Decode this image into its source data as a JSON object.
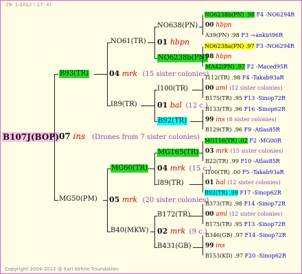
{
  "header": "29- 1-2012 ( 17: 4)",
  "copyright": "Copyright 2004-2012 @ Karl Kehrle Foundation.",
  "root": {
    "name": "B107J(BOP)",
    "num": "07",
    "qual": "ins",
    "note": "(Drones from 7 sister colonies)"
  },
  "g1": [
    {
      "name": "B93(TR)",
      "num": "04",
      "qual": "mrk",
      "note": "(15 sister colonies)"
    },
    {
      "name": "MG50(PM)",
      "num": "05",
      "qual": "mrk",
      "note": "(20 sister colonies)"
    }
  ],
  "g2": [
    {
      "name": "NO61(TR)",
      "num": "01",
      "qual": "hbpn",
      "note": ""
    },
    {
      "name": "I89(TR)",
      "num": "01",
      "qual": "bal",
      "note": "(12 c.)"
    },
    {
      "name": "MG60(TR)",
      "num": "04",
      "qual": "mrk",
      "note": "(15 c.)"
    },
    {
      "name": "B40(MKW)",
      "num": "02",
      "qual": "mrk",
      "note": "(9 c.)"
    }
  ],
  "g3": [
    {
      "name": "NO638(PN)",
      "num": "00",
      "qual": "hbpn",
      "note": ""
    },
    {
      "name": "NO6238b(PN)",
      "num": "98",
      "qual": "hbpn",
      "note": ""
    },
    {
      "name": "I100(TR)",
      "num": "00",
      "qual": "aml",
      "note": "(12 sister colonies)"
    },
    {
      "name": "B92(TR)",
      "num": "99",
      "qual": "ins",
      "note": "(8 sister colonies)"
    },
    {
      "name": "MG165(TR)",
      "num": "03",
      "qual": "mrk",
      "note": "(15 sister colonies)"
    },
    {
      "name": "I89(TR)",
      "num": "01",
      "qual": "bal",
      "note": "(12 sister colonies)"
    },
    {
      "name": "B172(TR)",
      "num": "00",
      "qual": "aml",
      "note": "(12 sister colonies)"
    },
    {
      "name": "B431(GB)",
      "num": "99",
      "qual": "ins",
      "note": ""
    }
  ],
  "g4": [
    {
      "name": "NO6238b(PN) .98",
      "code": "F4 -NO6294R"
    },
    {
      "name": "A39(PN) .98",
      "code": "F3 -«ankiri96R"
    },
    {
      "name": "NO6238a(PN) .97",
      "code": "F3 -NO6294R"
    },
    {
      "name": "MA42(PN) .97",
      "code": "F2 -Maced95R"
    },
    {
      "name": "I112(TR) .98",
      "code": "F4 -Takab93aR"
    },
    {
      "name": "B175(TR) .95",
      "code": "F13 -Sinop72R"
    },
    {
      "name": "B133(TR) .96",
      "code": "F16 -Sinop62R"
    },
    {
      "name": "B129(TR) .96",
      "code": "F9 -Atlas85R"
    },
    {
      "name": "MG116(TR) .02",
      "code": "F2 -MG00R"
    },
    {
      "name": "B22(TR) .99",
      "code": "F10 -Atlas85R"
    },
    {
      "name": "I100(TR) .00",
      "code": "F5 -Takab93aR"
    },
    {
      "name": "B92(TR) .99",
      "code": "F17 -Sinop62R"
    },
    {
      "name": "B373(TR) .98",
      "code": "F14 -Sinop72R"
    },
    {
      "name": "B175(TR) .95",
      "code": "F13 -Sinop72R"
    },
    {
      "name": "B346(GB) .97",
      "code": "F14 -Sinop72R"
    },
    {
      "name": "B153(KD) .97",
      "code": "F20 -Sinop62R"
    }
  ]
}
